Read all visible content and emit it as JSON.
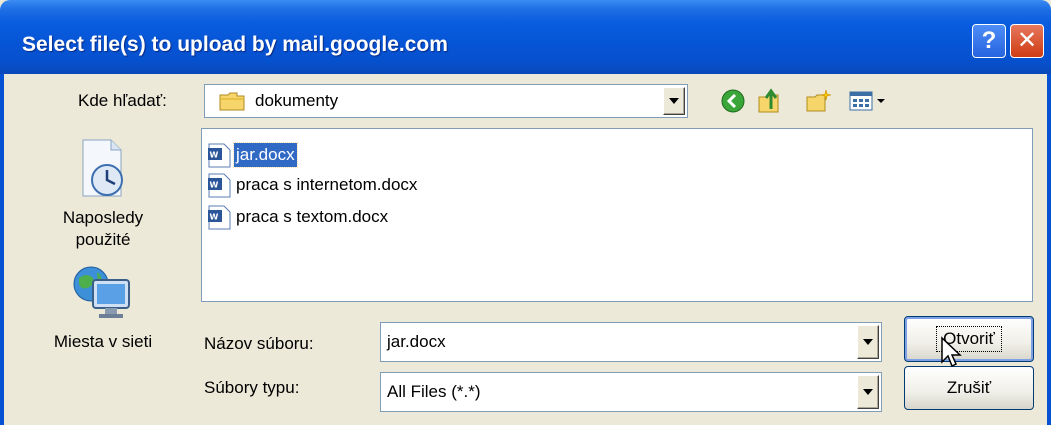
{
  "window": {
    "title": "Select file(s) to upload by mail.google.com",
    "help_button": "?",
    "close_button": "✕"
  },
  "location": {
    "label": "Kde hľadať:",
    "current_folder": "dokumenty",
    "toolbar_icons": [
      "back-icon",
      "up-folder-icon",
      "new-folder-icon",
      "view-menu-icon"
    ]
  },
  "places": [
    {
      "label_line1": "Naposledy",
      "label_line2": "použité",
      "icon": "recent-documents-icon"
    },
    {
      "label_line1": "Miesta v sieti",
      "label_line2": "",
      "icon": "network-places-icon"
    }
  ],
  "files": [
    {
      "name": "jar.docx",
      "selected": true,
      "icon": "word-document-icon"
    },
    {
      "name": "praca s internetom.docx",
      "selected": false,
      "icon": "word-document-icon"
    },
    {
      "name": "praca s textom.docx",
      "selected": false,
      "icon": "word-document-icon"
    }
  ],
  "filename": {
    "label": "Názov súboru:",
    "value": "jar.docx"
  },
  "filetype": {
    "label": "Súbory typu:",
    "value": "All Files (*.*)"
  },
  "buttons": {
    "open": "Otvoriť",
    "cancel": "Zrušiť"
  },
  "colors": {
    "title_bar": "#0654d6",
    "selection": "#316ac5",
    "dialog_bg": "#ece9d8"
  }
}
